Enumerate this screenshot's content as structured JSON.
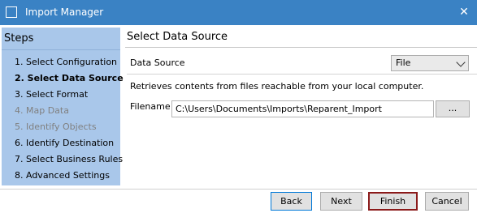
{
  "window": {
    "title": "Import Manager",
    "close_glyph": "✕"
  },
  "steps": {
    "header": "Steps",
    "items": [
      {
        "label": "1. Select Configuration",
        "state": "normal"
      },
      {
        "label": "2. Select Data Source",
        "state": "active"
      },
      {
        "label": "3. Select Format",
        "state": "normal"
      },
      {
        "label": "4. Map Data",
        "state": "disabled"
      },
      {
        "label": "5. Identify Objects",
        "state": "disabled"
      },
      {
        "label": "6. Identify Destination",
        "state": "normal"
      },
      {
        "label": "7. Select Business Rules",
        "state": "normal"
      },
      {
        "label": "8. Advanced Settings",
        "state": "normal"
      }
    ]
  },
  "main": {
    "title": "Select Data Source",
    "data_source_label": "Data Source",
    "data_source_value": "File",
    "description": "Retrieves contents from files reachable from your local computer.",
    "filename_label": "Filename",
    "filename_value": "C:\\Users\\Documents\\Imports\\Reparent_Import",
    "browse_label": "..."
  },
  "footer": {
    "back_label": "Back",
    "next_label": "Next",
    "finish_label": "Finish",
    "cancel_label": "Cancel"
  },
  "colors": {
    "titlebar": "#3a82c4",
    "steps_panel": "#a9c7ea",
    "finish_highlight": "#8b1a1a"
  }
}
